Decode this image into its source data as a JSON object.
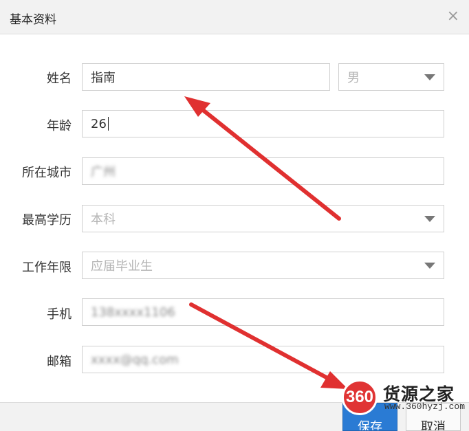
{
  "dialog": {
    "title": "基本资料",
    "close_glyph": "×"
  },
  "form": {
    "name_label": "姓名",
    "name_value": "指南",
    "gender_value": "男",
    "age_label": "年龄",
    "age_value": "26",
    "city_label": "所在城市",
    "city_value": "广州",
    "education_label": "最高学历",
    "education_value": "本科",
    "experience_label": "工作年限",
    "experience_value": "应届毕业生",
    "phone_label": "手机",
    "phone_value": "138xxxx1106",
    "email_label": "邮箱",
    "email_value": "xxxx@qq.com"
  },
  "buttons": {
    "save": "保存",
    "cancel": "取消"
  },
  "watermark": {
    "badge": "360",
    "name": "货源之家",
    "url": "www.360hyzj.com"
  },
  "colors": {
    "primary_button": "#2a7bd4",
    "arrow": "#e03030",
    "badge": "#e03434"
  },
  "icons": [
    "close-icon",
    "chevron-down-icon",
    "annotation-arrow-icon"
  ]
}
